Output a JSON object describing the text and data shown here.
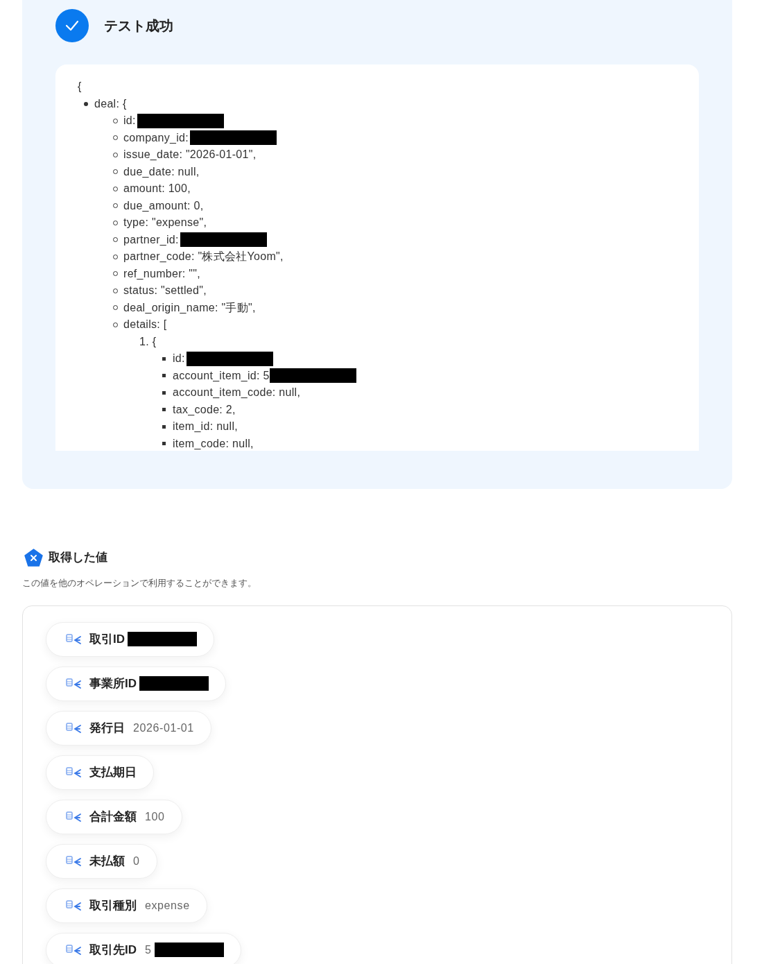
{
  "result": {
    "title": "テスト成功",
    "json_view": {
      "open": "{",
      "items": [
        {
          "text": "deal: {",
          "children": [
            {
              "text": "id:",
              "redacted": true
            },
            {
              "text": "company_id:",
              "redacted": true
            },
            {
              "text": "issue_date: \"2026-01-01\","
            },
            {
              "text": "due_date: null,"
            },
            {
              "text": "amount: 100,"
            },
            {
              "text": "due_amount: 0,"
            },
            {
              "text": "type: \"expense\","
            },
            {
              "text": "partner_id:",
              "redacted": true
            },
            {
              "text": "partner_code: \"株式会社Yoom\","
            },
            {
              "text": "ref_number: \"\","
            },
            {
              "text": "status: \"settled\","
            },
            {
              "text": "deal_origin_name: \"手動\","
            },
            {
              "text": "details: [",
              "children": [
                {
                  "text": "1. {",
                  "children": [
                    {
                      "text": "id:",
                      "redacted": true
                    },
                    {
                      "text": "account_item_id: 5",
                      "redacted": true
                    },
                    {
                      "text": "account_item_code: null,"
                    },
                    {
                      "text": "tax_code: 2,"
                    },
                    {
                      "text": "item_id: null,"
                    },
                    {
                      "text": "item_code: null,"
                    }
                  ]
                }
              ]
            }
          ]
        }
      ]
    }
  },
  "values": {
    "title": "取得した値",
    "description": "この値を他のオペレーションで利用することができます。",
    "chips": [
      {
        "label": "取引ID",
        "redacted": true
      },
      {
        "label": "事業所ID",
        "redacted": true
      },
      {
        "label": "発行日",
        "value": "2026-01-01"
      },
      {
        "label": "支払期日"
      },
      {
        "label": "合計金額",
        "value": "100"
      },
      {
        "label": "未払額",
        "value": "0"
      },
      {
        "label": "取引種別",
        "value": "expense"
      },
      {
        "label": "取引先ID",
        "value": "5",
        "redacted": true
      }
    ]
  }
}
